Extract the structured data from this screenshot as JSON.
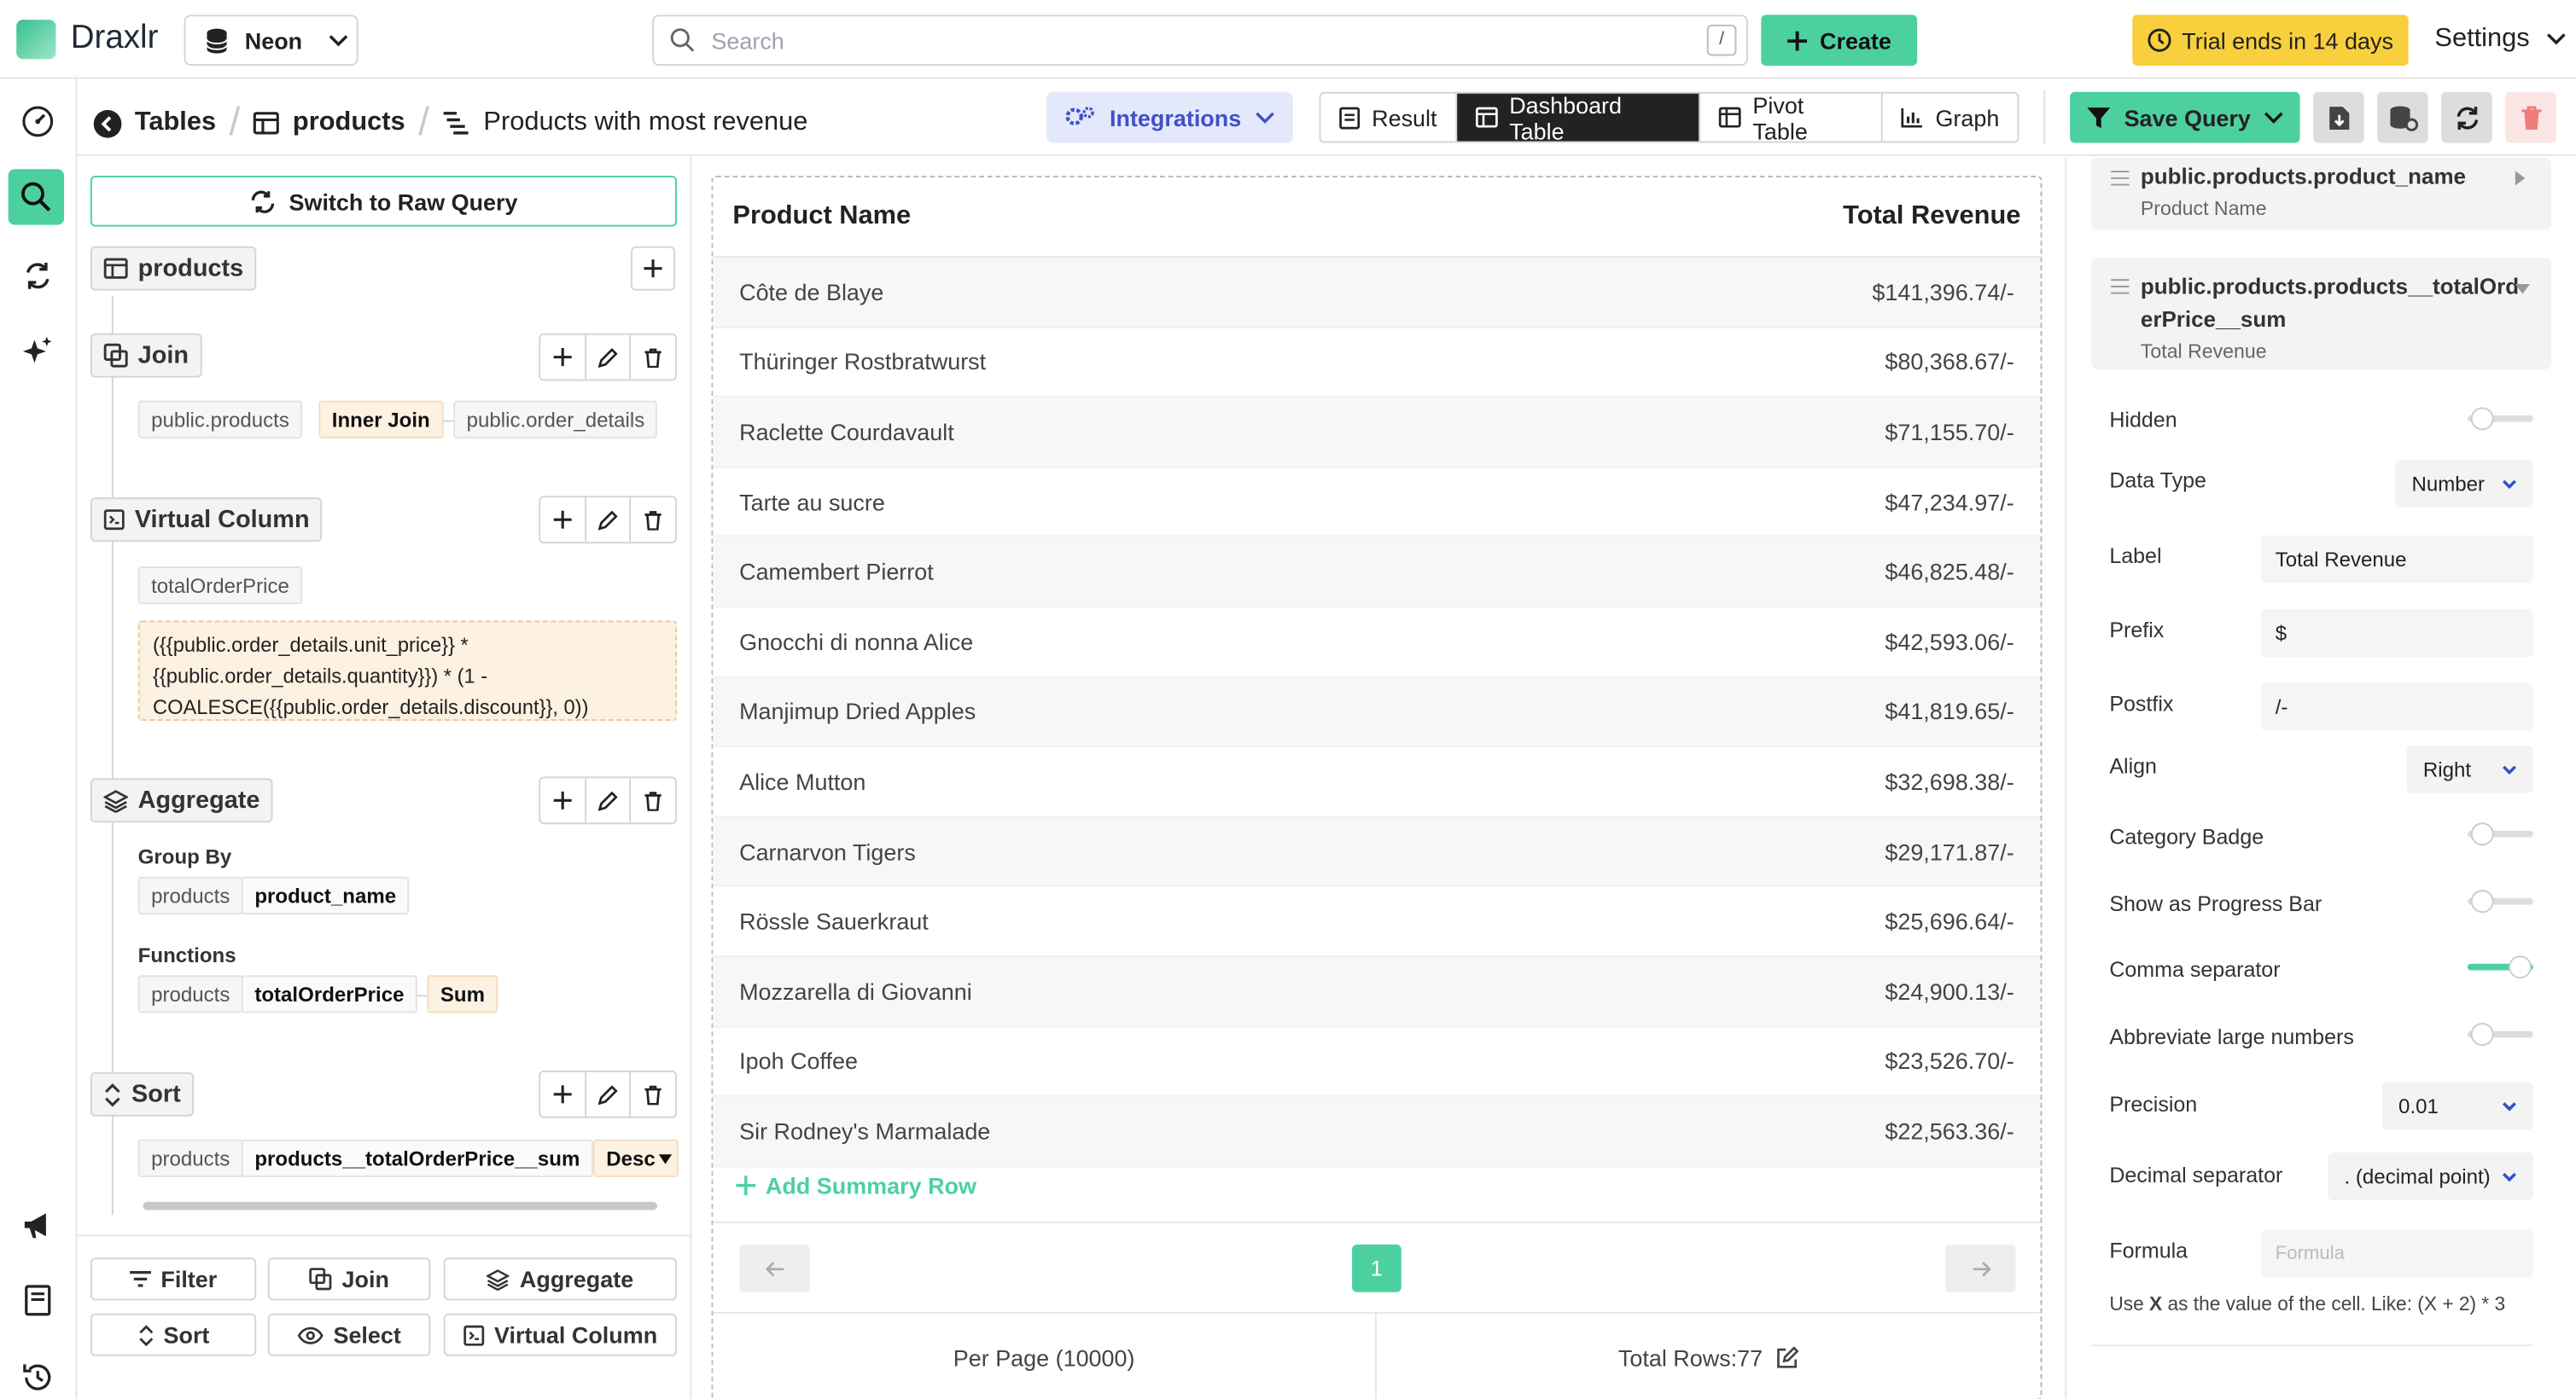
{
  "app": {
    "brand": "Draxlr",
    "database": "Neon"
  },
  "search": {
    "placeholder": "Search",
    "shortcut": "/"
  },
  "topbar": {
    "create_label": "Create",
    "trial_label": "Trial ends in 14 days",
    "settings_label": "Settings"
  },
  "breadcrumb": {
    "tables": "Tables",
    "table": "products",
    "query": "Products with most revenue"
  },
  "toolbar": {
    "integrations_label": "Integrations",
    "views": [
      "Result",
      "Dashboard Table",
      "Pivot Table",
      "Graph"
    ],
    "active_view": "Dashboard Table",
    "save_label": "Save Query"
  },
  "builder": {
    "raw_query_label": "Switch to Raw Query",
    "base_table": "products",
    "join": {
      "title": "Join",
      "left": "public.products",
      "type": "Inner Join",
      "right": "public.order_details"
    },
    "virtual_column": {
      "title": "Virtual Column",
      "name": "totalOrderPrice",
      "formula_lines": [
        "({{public.order_details.unit_price}} *",
        "{{public.order_details.quantity}}) * (1 -",
        "COALESCE({{public.order_details.discount}}, 0))"
      ]
    },
    "aggregate": {
      "title": "Aggregate",
      "group_by_label": "Group By",
      "group_table": "products",
      "group_column": "product_name",
      "functions_label": "Functions",
      "fn_table": "products",
      "fn_column": "totalOrderPrice",
      "fn": "Sum"
    },
    "sort": {
      "title": "Sort",
      "table": "products",
      "column": "products__totalOrderPrice__sum",
      "direction": "Desc"
    },
    "add_buttons": [
      "Filter",
      "Join",
      "Aggregate",
      "Sort",
      "Select",
      "Virtual Column"
    ]
  },
  "result": {
    "columns": [
      "Product Name",
      "Total Revenue"
    ],
    "rows": [
      [
        "Côte de Blaye",
        "$141,396.74/-"
      ],
      [
        "Thüringer Rostbratwurst",
        "$80,368.67/-"
      ],
      [
        "Raclette Courdavault",
        "$71,155.70/-"
      ],
      [
        "Tarte au sucre",
        "$47,234.97/-"
      ],
      [
        "Camembert Pierrot",
        "$46,825.48/-"
      ],
      [
        "Gnocchi di nonna Alice",
        "$42,593.06/-"
      ],
      [
        "Manjimup Dried Apples",
        "$41,819.65/-"
      ],
      [
        "Alice Mutton",
        "$32,698.38/-"
      ],
      [
        "Carnarvon Tigers",
        "$29,171.87/-"
      ],
      [
        "Rössle Sauerkraut",
        "$25,696.64/-"
      ],
      [
        "Mozzarella di Giovanni",
        "$24,900.13/-"
      ],
      [
        "Ipoh Coffee",
        "$23,526.70/-"
      ],
      [
        "Sir Rodney's Marmalade",
        "$22,563.36/-"
      ]
    ],
    "add_summary_label": "Add Summary Row",
    "page": "1",
    "per_page_label": "Per Page (10000)",
    "total_rows_label": "Total Rows:77"
  },
  "config": {
    "col1": {
      "path": "public.products.product_name",
      "label": "Product Name"
    },
    "col2": {
      "path_line1": "public.products.products__totalOrd",
      "path_line2": "erPrice__sum",
      "label": "Total Revenue"
    },
    "hidden_label": "Hidden",
    "data_type_label": "Data Type",
    "data_type_value": "Number",
    "label_label": "Label",
    "label_value": "Total Revenue",
    "prefix_label": "Prefix",
    "prefix_value": "$",
    "postfix_label": "Postfix",
    "postfix_value": "/-",
    "align_label": "Align",
    "align_value": "Right",
    "category_badge_label": "Category Badge",
    "progress_bar_label": "Show as Progress Bar",
    "comma_label": "Comma separator",
    "abbreviate_label": "Abbreviate large numbers",
    "precision_label": "Precision",
    "precision_value": "0.01",
    "decimal_label": "Decimal separator",
    "decimal_value": ". (decimal point)",
    "formula_label": "Formula",
    "formula_placeholder": "Formula",
    "formula_hint_prefix": "Use ",
    "formula_hint_x": "X",
    "formula_hint_suffix": " as the value of the cell. Like: (X + 2) * 3"
  },
  "colors": {
    "accent": "#4dd0a0",
    "trial": "#f8cf3c",
    "integrations_bg": "#e4e8fb",
    "delete": "#f27c7c"
  }
}
